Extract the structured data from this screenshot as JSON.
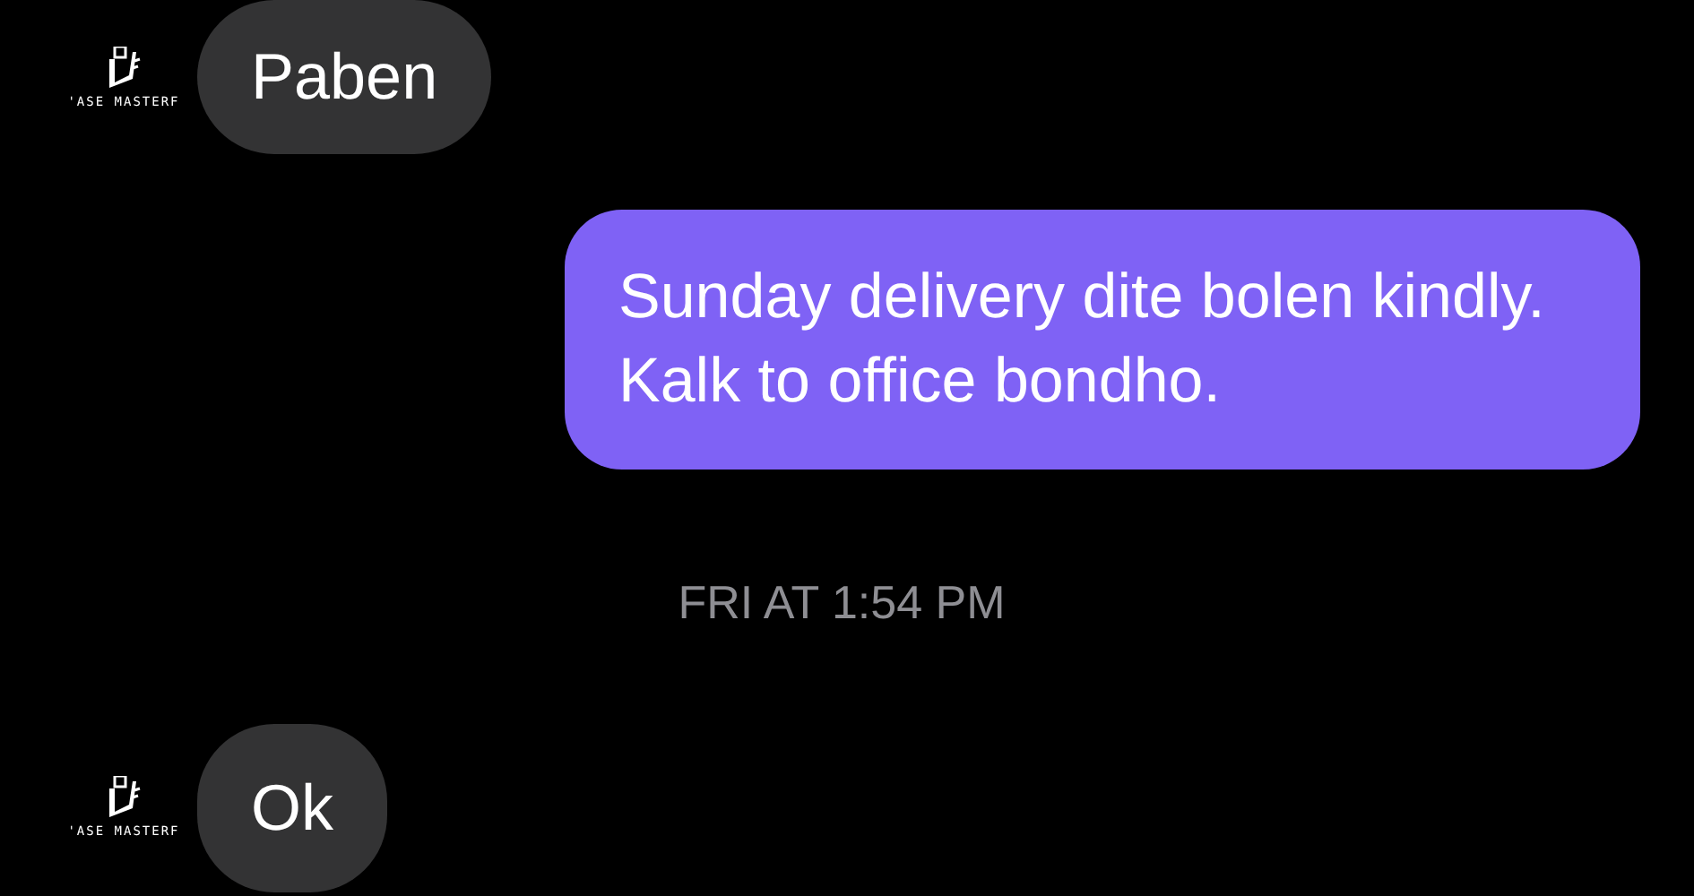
{
  "messages": [
    {
      "kind": "incoming",
      "text": "Paben",
      "avatar": {
        "caption": "'ASE MASTERF"
      }
    },
    {
      "kind": "outgoing",
      "text": "Sunday delivery dite bolen kindly. Kalk to office bondho."
    },
    {
      "kind": "timestamp",
      "text": "FRI AT 1:54 PM"
    },
    {
      "kind": "incoming",
      "text": "Ok",
      "avatar": {
        "caption": "'ASE MASTERF"
      }
    }
  ]
}
